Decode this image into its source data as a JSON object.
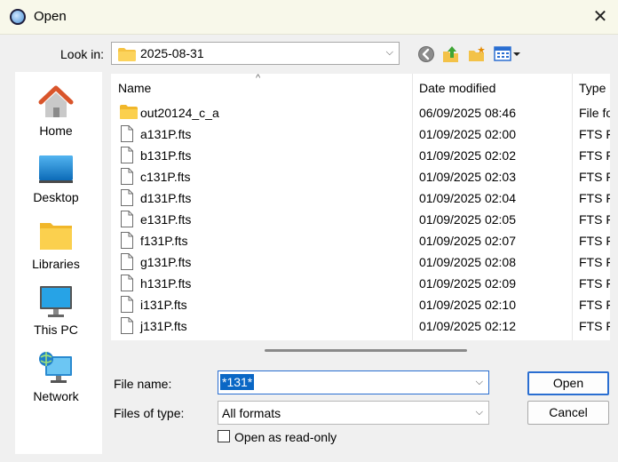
{
  "window": {
    "title": "Open",
    "close_glyph": "✕"
  },
  "lookin": {
    "label": "Look in:",
    "value": "2025-08-31",
    "chevron": "⌵"
  },
  "toolbar": {
    "icons": [
      "back-icon",
      "up-folder-icon",
      "new-folder-icon",
      "view-menu-icon"
    ]
  },
  "places": [
    {
      "label": "Home",
      "icon": "home-icon"
    },
    {
      "label": "Desktop",
      "icon": "desktop-icon"
    },
    {
      "label": "Libraries",
      "icon": "libraries-icon"
    },
    {
      "label": "This PC",
      "icon": "this-pc-icon"
    },
    {
      "label": "Network",
      "icon": "network-icon"
    }
  ],
  "file_list": {
    "columns": {
      "name": "Name",
      "date": "Date modified",
      "type": "Type"
    },
    "sort_glyph": "^",
    "rows": [
      {
        "name": "out20124_c_a",
        "date": "06/09/2025 08:46",
        "type": "File fo",
        "kind": "folder"
      },
      {
        "name": "a131P.fts",
        "date": "01/09/2025 02:00",
        "type": "FTS F",
        "kind": "file"
      },
      {
        "name": "b131P.fts",
        "date": "01/09/2025 02:02",
        "type": "FTS F",
        "kind": "file"
      },
      {
        "name": "c131P.fts",
        "date": "01/09/2025 02:03",
        "type": "FTS F",
        "kind": "file"
      },
      {
        "name": "d131P.fts",
        "date": "01/09/2025 02:04",
        "type": "FTS F",
        "kind": "file"
      },
      {
        "name": "e131P.fts",
        "date": "01/09/2025 02:05",
        "type": "FTS F",
        "kind": "file"
      },
      {
        "name": "f131P.fts",
        "date": "01/09/2025 02:07",
        "type": "FTS F",
        "kind": "file"
      },
      {
        "name": "g131P.fts",
        "date": "01/09/2025 02:08",
        "type": "FTS F",
        "kind": "file"
      },
      {
        "name": "h131P.fts",
        "date": "01/09/2025 02:09",
        "type": "FTS F",
        "kind": "file"
      },
      {
        "name": "i131P.fts",
        "date": "01/09/2025 02:10",
        "type": "FTS F",
        "kind": "file"
      },
      {
        "name": "j131P.fts",
        "date": "01/09/2025 02:12",
        "type": "FTS F",
        "kind": "file"
      }
    ]
  },
  "form": {
    "file_name_label": "File name:",
    "file_name_value": "*131*",
    "files_of_type_label": "Files of type:",
    "files_of_type_value": "All formats",
    "read_only_label": "Open as read-only",
    "read_only_checked": false,
    "chevron": "⌵"
  },
  "buttons": {
    "open": "Open",
    "cancel": "Cancel"
  },
  "colors": {
    "selection": "#0a67c5",
    "focus_border": "#2a6ed1",
    "folder": "#f6c342"
  }
}
